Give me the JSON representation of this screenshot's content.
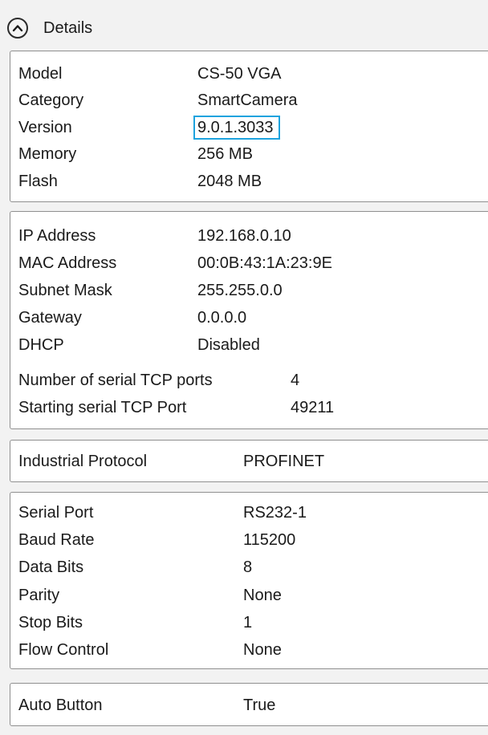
{
  "header": {
    "title": "Details"
  },
  "device": {
    "model_label": "Model",
    "model_value": "CS-50 VGA",
    "category_label": "Category",
    "category_value": "SmartCamera",
    "version_label": "Version",
    "version_value": "9.0.1.3033",
    "memory_label": "Memory",
    "memory_value": "256 MB",
    "flash_label": "Flash",
    "flash_value": "2048 MB"
  },
  "network": {
    "ip_label": "IP Address",
    "ip_value": "192.168.0.10",
    "mac_label": "MAC Address",
    "mac_value": "00:0B:43:1A:23:9E",
    "subnet_label": "Subnet Mask",
    "subnet_value": "255.255.0.0",
    "gateway_label": "Gateway",
    "gateway_value": "0.0.0.0",
    "dhcp_label": "DHCP",
    "dhcp_value": "Disabled",
    "tcp_ports_label": "Number of serial TCP ports",
    "tcp_ports_value": "4",
    "start_port_label": "Starting serial TCP Port",
    "start_port_value": "49211"
  },
  "protocol": {
    "label": "Industrial Protocol",
    "value": "PROFINET"
  },
  "serial": {
    "port_label": "Serial Port",
    "port_value": "RS232-1",
    "baud_label": "Baud Rate",
    "baud_value": "115200",
    "data_bits_label": "Data Bits",
    "data_bits_value": "8",
    "parity_label": "Parity",
    "parity_value": "None",
    "stop_bits_label": "Stop Bits",
    "stop_bits_value": "1",
    "flow_label": "Flow Control",
    "flow_value": "None"
  },
  "auto": {
    "label": "Auto Button",
    "value": "True"
  },
  "colors": {
    "background": "#f2f2f2",
    "panel": "#ffffff",
    "border": "#8f8f8f",
    "highlight": "#1ea3de"
  },
  "icons": {
    "collapse": "chevron-up-icon"
  }
}
